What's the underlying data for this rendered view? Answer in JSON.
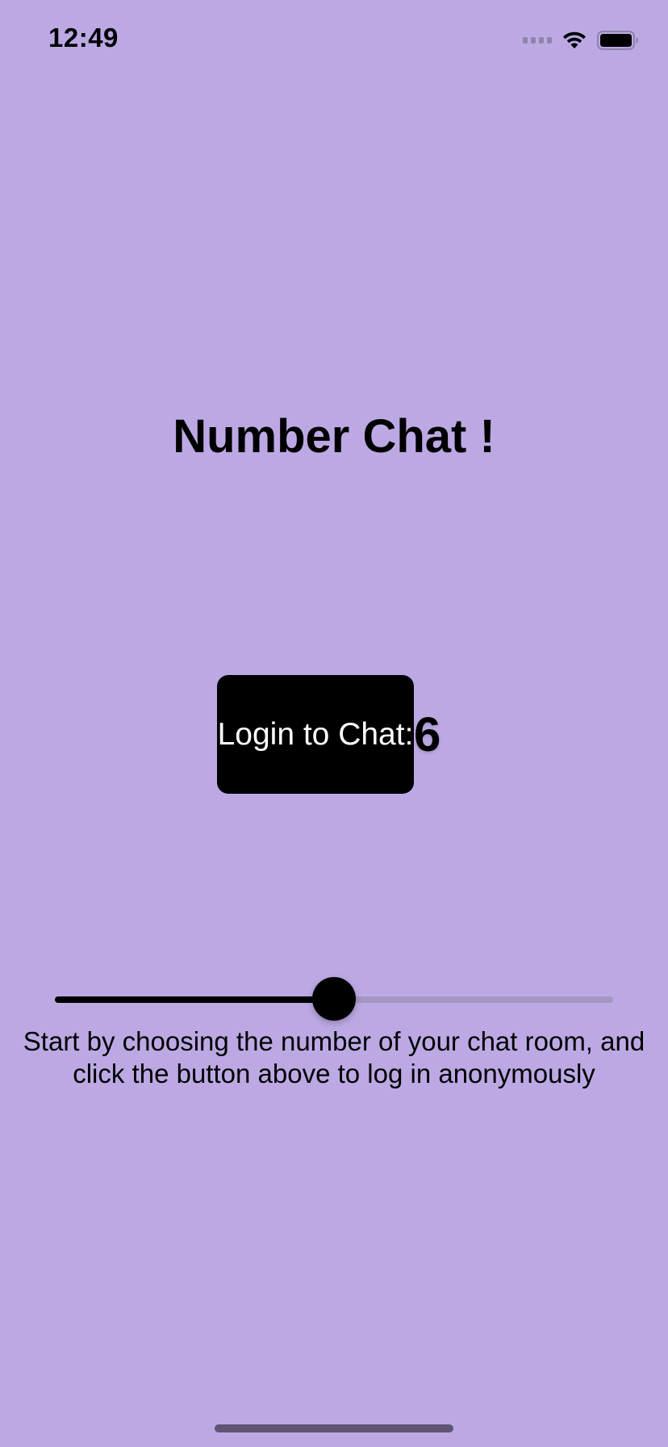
{
  "status_bar": {
    "time": "12:49",
    "icons": [
      "signal-icon",
      "wifi-icon",
      "battery-icon"
    ]
  },
  "title": "Number Chat !",
  "login_button": {
    "label": "Login to Chat:"
  },
  "room_number": "6",
  "slider": {
    "value_fraction": 0.5
  },
  "instructions": {
    "line1": "Start by choosing the number of your chat room, and",
    "line2": "click the button above to log in anonymously"
  },
  "colors": {
    "background": "#bca9e4",
    "button": "#000000",
    "track_inactive": "#a596c3"
  }
}
